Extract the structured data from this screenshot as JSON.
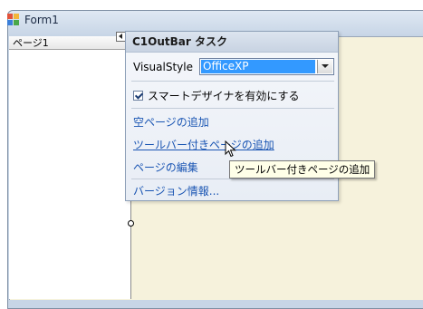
{
  "form": {
    "title": "Form1",
    "page_tab_label": "ページ1"
  },
  "smart_tag": {
    "header": "C1OutBar タスク",
    "visual_style_label": "VisualStyle",
    "visual_style_value": "OfficeXP",
    "checkbox_label": "スマートデザイナを有効にする",
    "checkbox_checked": true,
    "links": [
      "空ページの追加",
      "ツールバー付きページの追加",
      "ページの編集",
      "バージョン情報..."
    ]
  },
  "tooltip": {
    "text": "ツールバー付きページの追加"
  },
  "colors": {
    "selection": "#3399ff",
    "link": "#1a55b3",
    "client_background": "#f6f2dc",
    "tooltip_background": "#ffffe8"
  }
}
